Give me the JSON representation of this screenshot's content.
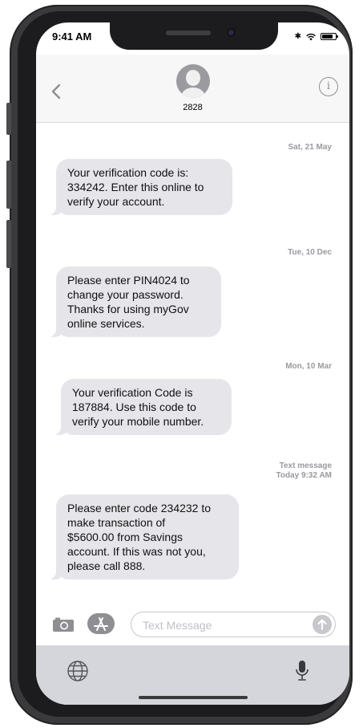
{
  "status_bar": {
    "time": "9:41 AM",
    "icons": [
      "bluetooth-icon",
      "wifi-icon",
      "battery-icon"
    ]
  },
  "header": {
    "contact_name": "2828",
    "back_icon": "chevron-left-icon",
    "info_icon": "info-icon",
    "info_glyph": "i"
  },
  "messages": [
    {
      "timestamp": "Sat, 21 May",
      "timestamp_sub": "",
      "lines": [
        "Your verification code is:",
        "334242. Enter this online to",
        "verify your account."
      ]
    },
    {
      "timestamp": "Tue, 10 Dec",
      "timestamp_sub": "",
      "lines": [
        "Please enter PIN4024 to",
        "change your password.",
        "Thanks for using myGov",
        "online services."
      ]
    },
    {
      "timestamp": "Mon, 10 Mar",
      "timestamp_sub": "",
      "lines": [
        "Your verification Code is",
        "187884. Use this code to",
        "verify your mobile number."
      ]
    },
    {
      "timestamp": "Text message",
      "timestamp_sub": "Today 9:32 AM",
      "lines": [
        "Please enter code 234232 to",
        "make transaction of",
        "$5600.00 from Savings",
        "account. If this was not you,",
        "please call 888."
      ]
    }
  ],
  "compose": {
    "placeholder": "Text Message",
    "value": "",
    "camera_icon": "camera-icon",
    "apps_icon": "app-store-icon",
    "send_icon": "arrow-up-icon"
  },
  "keyboard": {
    "globe_icon": "globe-icon",
    "mic_icon": "microphone-icon"
  },
  "colors": {
    "bubble_received": "#e5e5ea",
    "timestamp": "#9a9aa0",
    "header_bg": "#f7f7f7",
    "phone_frame": "#3a3a3c",
    "keyboard_bg": "#d4d6db"
  }
}
